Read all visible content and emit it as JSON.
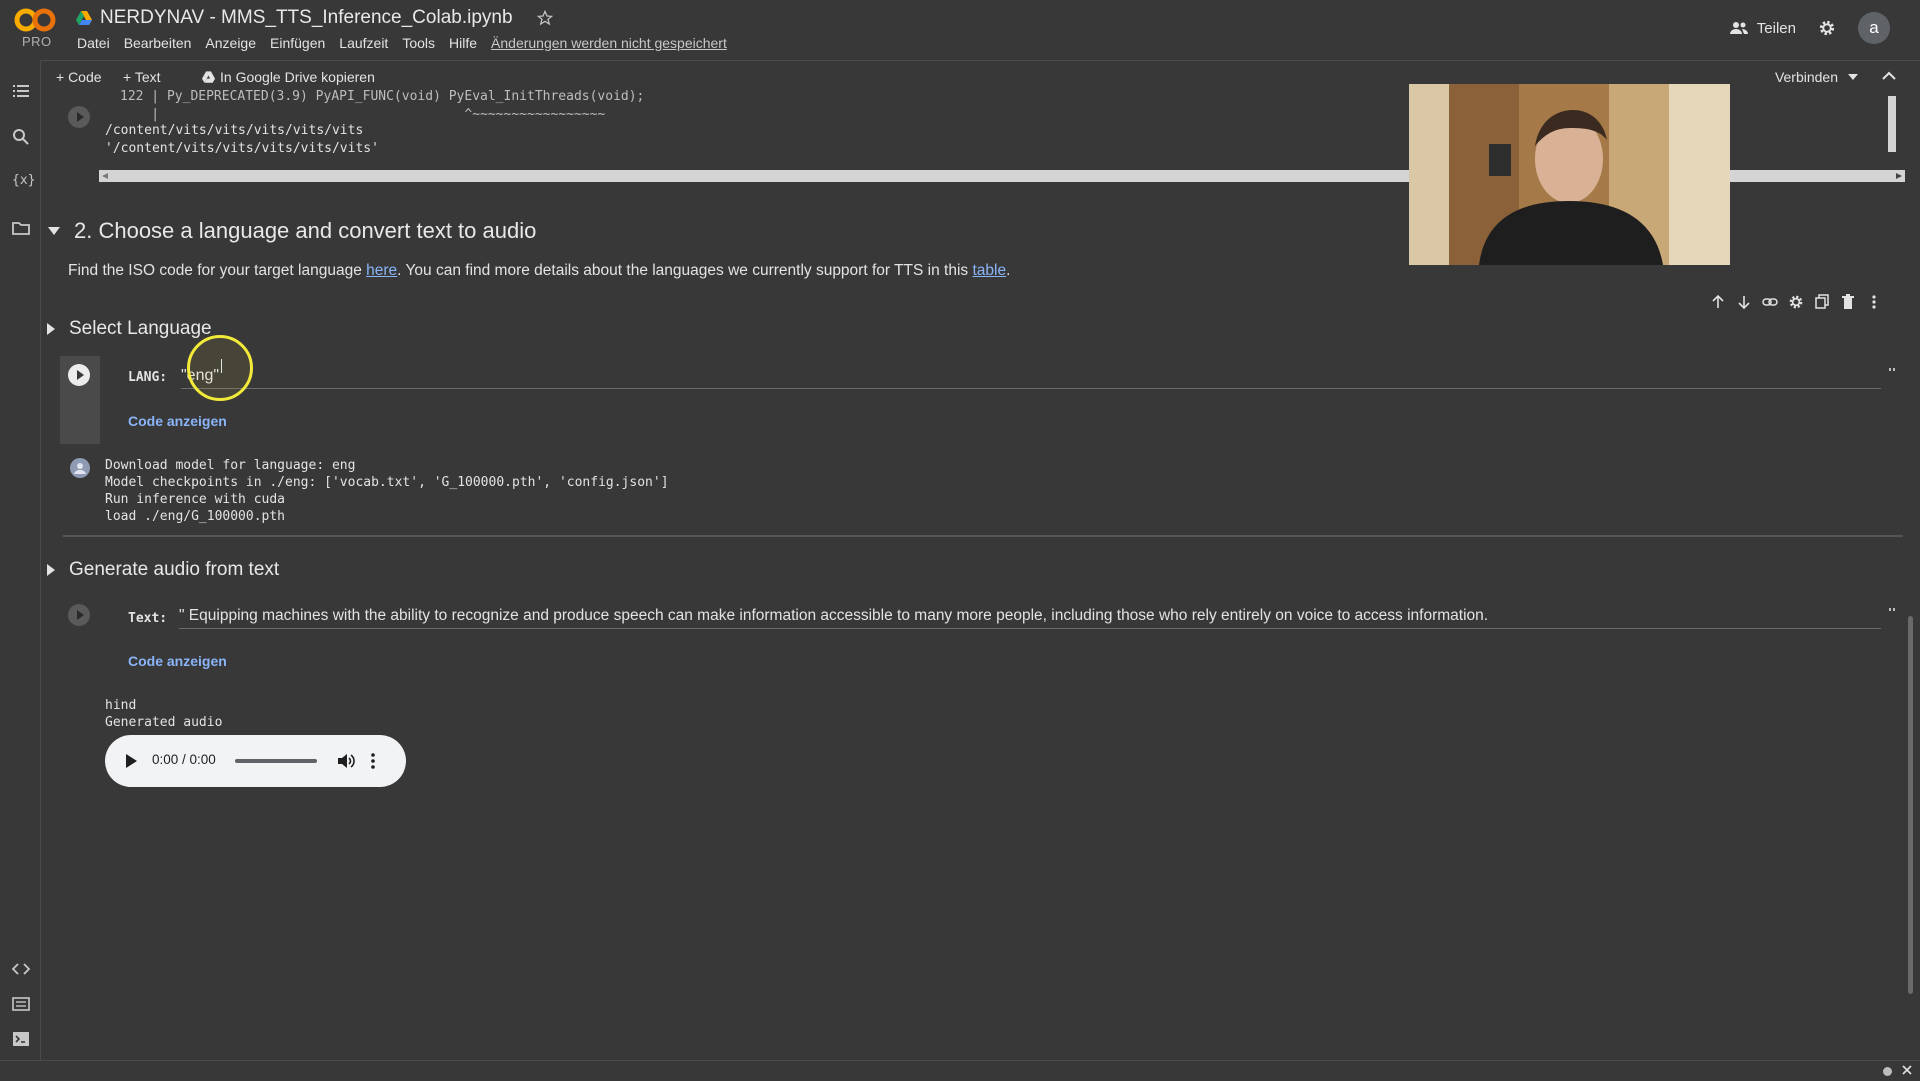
{
  "app": {
    "logo_text": "CO",
    "plan_badge": "PRO",
    "title": "NERDYNAV - MMS_TTS_Inference_Colab.ipynb"
  },
  "menu": [
    "Datei",
    "Bearbeiten",
    "Anzeige",
    "Einfügen",
    "Laufzeit",
    "Tools",
    "Hilfe"
  ],
  "unsaved_notice": "Änderungen werden nicht gespeichert",
  "header_right": {
    "share_label": "Teilen",
    "avatar_letter": "a"
  },
  "toolbar": {
    "code_label": "+ Code",
    "text_label": "+ Text",
    "drive_label": "In Google Drive kopieren",
    "connect_label": "Verbinden"
  },
  "top_output": {
    "line_partial_1": "122 | Py_DEPRECATED(3.9) PyAPI_FUNC(void) PyEval_InitThreads(void);",
    "line_partial_2": "    |                                       ^~~~~~~~~~~~~~~~~~",
    "line_1": "/content/vits/vits/vits/vits/vits",
    "line_2": "'/content/vits/vits/vits/vits/vits'"
  },
  "section2": {
    "heading": "2. Choose a language and convert text to audio",
    "intro_before": "Find the ISO code for your target language ",
    "intro_link1": "here",
    "intro_middle": ". You can find more details about the languages we currently support for TTS in this ",
    "intro_link2": "table",
    "intro_after": "."
  },
  "select_language": {
    "heading": "Select Language",
    "field_label": "LANG:",
    "field_value": "\"eng\"",
    "show_code": "Code anzeigen",
    "output": [
      "Download model for language: eng",
      "Model checkpoints in ./eng: ['vocab.txt', 'G_100000.pth', 'config.json']",
      "Run inference with cuda",
      "load ./eng/G_100000.pth"
    ]
  },
  "generate_audio": {
    "heading": "Generate audio from text",
    "field_label": "Text:",
    "field_value": "\" Equipping machines with the ability to recognize and produce speech can make information accessible to many more people, including those who rely entirely on voice to access information.",
    "field_end_quote": "\"",
    "show_code": "Code anzeigen",
    "output": [
      "hind",
      "Generated audio"
    ],
    "player_time": "0:00 / 0:00"
  },
  "icons": {
    "rail": [
      "toc-icon",
      "search-icon",
      "variables-icon",
      "folder-icon",
      "code-snippets-icon",
      "command-palette-icon",
      "terminal-icon"
    ],
    "cell_toolbar": [
      "move-up-icon",
      "move-down-icon",
      "link-icon",
      "settings-icon",
      "mirror-cell-icon",
      "delete-icon",
      "more-vert-icon"
    ]
  },
  "colors": {
    "background": "#383838",
    "link": "#8ab4f8",
    "logo_orange": "#f9ab00",
    "cursor_highlight": "#f4ea3a"
  }
}
